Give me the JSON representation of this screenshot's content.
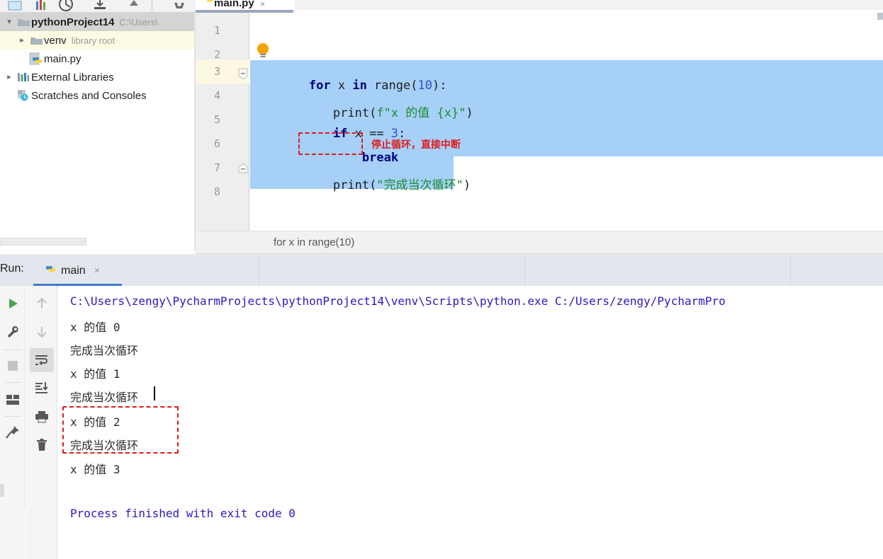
{
  "window": {
    "ide": "PyCharm",
    "accent_blue": "#3f7dc9",
    "selection_color": "#a6d0f7",
    "annotation_red": "#e01b1b",
    "keyword_color": "#000080",
    "string_color": "#1a8c2e",
    "number_color": "#2a4fd8",
    "console_blue": "#2b19c0"
  },
  "toolbar": {
    "icons": [
      "open-file-icon",
      "bar-chart-icon",
      "vcs-update-icon",
      "commit-icon",
      "push-icon",
      "settings-gear-icon"
    ]
  },
  "project_tree": {
    "items": [
      {
        "arrow": "chevron-down-icon",
        "icon": "folder-icon",
        "label": "pythonProject14",
        "sub": "C:\\Users\\",
        "state": "selected",
        "bold": true,
        "indent": 0
      },
      {
        "arrow": "chevron-right-icon",
        "icon": "folder-icon",
        "label": "venv",
        "sub": "library root",
        "state": "highlighted",
        "bold": false,
        "indent": 1
      },
      {
        "arrow": "",
        "icon": "python-file-icon",
        "label": "main.py",
        "sub": "",
        "state": "none",
        "bold": false,
        "indent": 1
      },
      {
        "arrow": "chevron-right-icon",
        "icon": "libraries-icon",
        "label": "External Libraries",
        "sub": "",
        "state": "none",
        "bold": false,
        "indent": 0
      },
      {
        "arrow": "",
        "icon": "scratches-icon",
        "label": "Scratches and Consoles",
        "sub": "",
        "state": "none",
        "bold": false,
        "indent": 0
      }
    ]
  },
  "editor": {
    "tab": {
      "icon": "python-file-icon",
      "name": "main.py",
      "close": "×"
    },
    "line_numbers": [
      "1",
      "2",
      "3",
      "4",
      "5",
      "6",
      "7",
      "8"
    ],
    "current_line": 3,
    "bulb_icon": "intention-bulb-icon",
    "code": {
      "line3": {
        "kw1": "for",
        "var": " x ",
        "kw2": "in",
        "fn": " range(",
        "num": "10",
        "tail": "):"
      },
      "line4": {
        "fn": "print(",
        "fstr_f": "f",
        "quote1": "\"",
        "str": "x 的值 {x}",
        "quote2": "\"",
        "tail": ")"
      },
      "line5": {
        "kw": "if",
        "var": " x == ",
        "num": "3",
        "tail": ":"
      },
      "line6": {
        "kw": "break"
      },
      "line7": {
        "fn": "print(",
        "quote1": "\"",
        "str": "完成当次循环",
        "quote2": "\"",
        "tail": ")"
      }
    },
    "annotation": "停止循环，直接中断",
    "breadcrumb": "for x in range(10)"
  },
  "run_window": {
    "label": "Run:",
    "tab": {
      "icon": "python-file-icon",
      "name": "main",
      "close": "×"
    },
    "left_toolbar": [
      {
        "name": "rerun-button",
        "icon": "run-play-icon"
      },
      {
        "name": "edit-configurations-button",
        "icon": "wrench-icon"
      },
      {
        "name": "stop-button",
        "icon": "stop-square-icon"
      },
      {
        "name": "layout-button",
        "icon": "layout-icon"
      },
      {
        "name": "pin-tab-button",
        "icon": "pin-icon"
      }
    ],
    "second_toolbar": [
      {
        "name": "scroll-up-button",
        "icon": "arrow-up-icon",
        "active": false
      },
      {
        "name": "scroll-down-button",
        "icon": "arrow-down-icon",
        "active": false
      },
      {
        "name": "soft-wrap-button",
        "icon": "soft-wrap-icon",
        "active": true
      },
      {
        "name": "scroll-to-end-button",
        "icon": "scroll-to-end-icon",
        "active": false
      },
      {
        "name": "print-button",
        "icon": "printer-icon",
        "active": false
      },
      {
        "name": "clear-all-button",
        "icon": "trash-icon",
        "active": false
      }
    ],
    "console_lines": [
      {
        "text": "C:\\Users\\zengy\\PycharmProjects\\pythonProject14\\venv\\Scripts\\python.exe C:/Users/zengy/PycharmPro",
        "style": "blue"
      },
      {
        "text": "x 的值 0",
        "style": "normal"
      },
      {
        "text": "完成当次循环",
        "style": "normal"
      },
      {
        "text": "x 的值 1",
        "style": "normal"
      },
      {
        "text": "完成当次循环",
        "style": "normal"
      },
      {
        "text": "x 的值 2",
        "style": "normal"
      },
      {
        "text": "完成当次循环",
        "style": "normal"
      },
      {
        "text": "x 的值 3",
        "style": "normal"
      },
      {
        "text": "",
        "style": "normal"
      },
      {
        "text": "Process finished with exit code 0",
        "style": "blue"
      }
    ]
  }
}
